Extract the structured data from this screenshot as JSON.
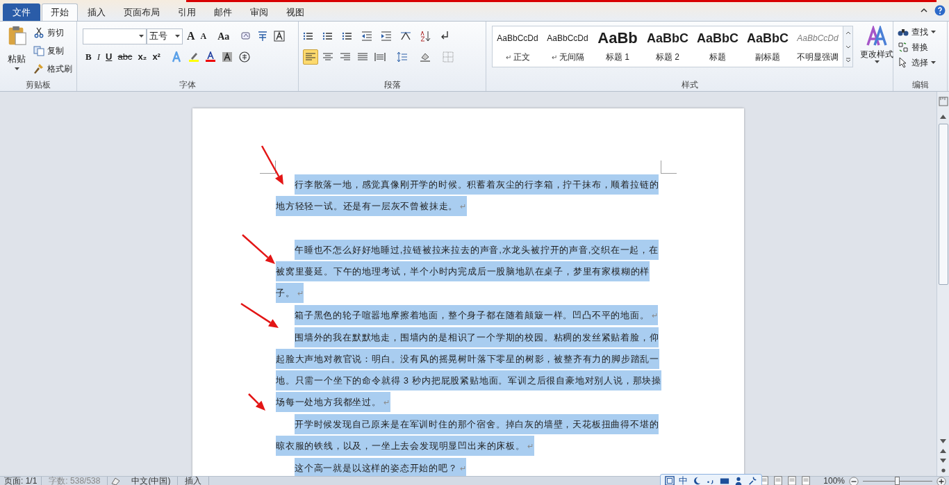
{
  "tabs": [
    {
      "label": "文件",
      "kind": "file",
      "selected": false
    },
    {
      "label": "开始",
      "kind": "tab",
      "selected": true
    },
    {
      "label": "插入",
      "kind": "tab",
      "selected": false
    },
    {
      "label": "页面布局",
      "kind": "tab",
      "selected": false
    },
    {
      "label": "引用",
      "kind": "tab",
      "selected": false
    },
    {
      "label": "邮件",
      "kind": "tab",
      "selected": false
    },
    {
      "label": "审阅",
      "kind": "tab",
      "selected": false
    },
    {
      "label": "视图",
      "kind": "tab",
      "selected": false
    }
  ],
  "clipboard": {
    "paste": "粘贴",
    "cut": "剪切",
    "copy": "复制",
    "format_painter": "格式刷",
    "label": "剪贴板"
  },
  "font": {
    "size": "五号",
    "grow": "A",
    "shrink": "A",
    "case": "Aa",
    "format_buttons": [
      "B",
      "I",
      "U",
      "abc",
      "x₂",
      "x²"
    ],
    "label": "字体"
  },
  "paragraph": {
    "alignments": [
      {
        "selected": true
      },
      {
        "selected": false
      },
      {
        "selected": false
      },
      {
        "selected": false
      },
      {
        "selected": false
      }
    ],
    "label": "段落"
  },
  "styles": {
    "items": [
      {
        "sample": "AaBbCcDd",
        "name": "正文",
        "mark": "↵",
        "kind": "normal"
      },
      {
        "sample": "AaBbCcDd",
        "name": "无间隔",
        "mark": "↵",
        "kind": "normal"
      },
      {
        "sample": "AaBb",
        "name": "标题 1",
        "kind": "heading1"
      },
      {
        "sample": "AaBbC",
        "name": "标题 2",
        "kind": "heading2"
      },
      {
        "sample": "AaBbC",
        "name": "标题",
        "kind": "heading2"
      },
      {
        "sample": "AaBbC",
        "name": "副标题",
        "kind": "heading2"
      },
      {
        "sample": "AaBbCcDd",
        "name": "不明显强调",
        "kind": "subtle"
      }
    ],
    "change": "更改样式",
    "label": "样式"
  },
  "editing": {
    "find": "查找",
    "replace": "替换",
    "select": "选择",
    "label": "编辑"
  },
  "document": {
    "paragraphs": [
      {
        "text": "行李散落一地，感觉真像刚开学的时候。积蓄着灰尘的行李箱，拧干抹布，顺着拉链的地方轻轻一试。还是有一层灰不曾被抹走。",
        "mark": "↵",
        "selected": true,
        "blank_after": true
      },
      {
        "text": "午睡也不怎么好好地睡过,拉链被拉来拉去的声音,水龙头被拧开的声音,交织在一起，在被窝里蔓延。下午的地理考试，半个小时内完成后一股脑地趴在桌子，梦里有家模糊的样子。",
        "mark": "↵",
        "selected": true,
        "blank_after": false
      },
      {
        "text": "箱子黑色的轮子喧嚣地摩擦着地面，整个身子都在随着颠簸一样。凹凸不平的地面。",
        "mark": "↵",
        "selected": true,
        "blank_after": false
      },
      {
        "text": "围墙外的我在默默地走，围墙内的是相识了一个学期的校园。粘稠的发丝紧贴着脸，仰起脸大声地对教官说：明白。没有风的摇晃树叶落下零星的树影，被整齐有力的脚步踏乱一地。只需一个坐下的命令就得 3 秒内把屁股紧贴地面。军训之后很自豪地对别人说，那块操场每一处地方我都坐过。",
        "mark": "↵",
        "selected": true,
        "blank_after": false
      },
      {
        "text": "开学时候发现自己原来是在军训时住的那个宿舍。掉白灰的墙壁，天花板扭曲得不堪的晾衣服的铁线，以及，一坐上去会发现明显凹出来的床板。",
        "mark": "↵",
        "selected": true,
        "blank_after": false
      },
      {
        "text": "这个高一就是以这样的姿态开始的吧？",
        "mark": "↵",
        "selected": true,
        "blank_after": false
      }
    ]
  },
  "status_bar": {
    "page": "页面: 1/1",
    "words": "字数: 538/538",
    "language": "中文(中国)",
    "mode": "插入",
    "zoom": "100%",
    "zoom_slider": {
      "level": 0.5
    }
  },
  "ime_toolbar": {
    "label": "中"
  }
}
